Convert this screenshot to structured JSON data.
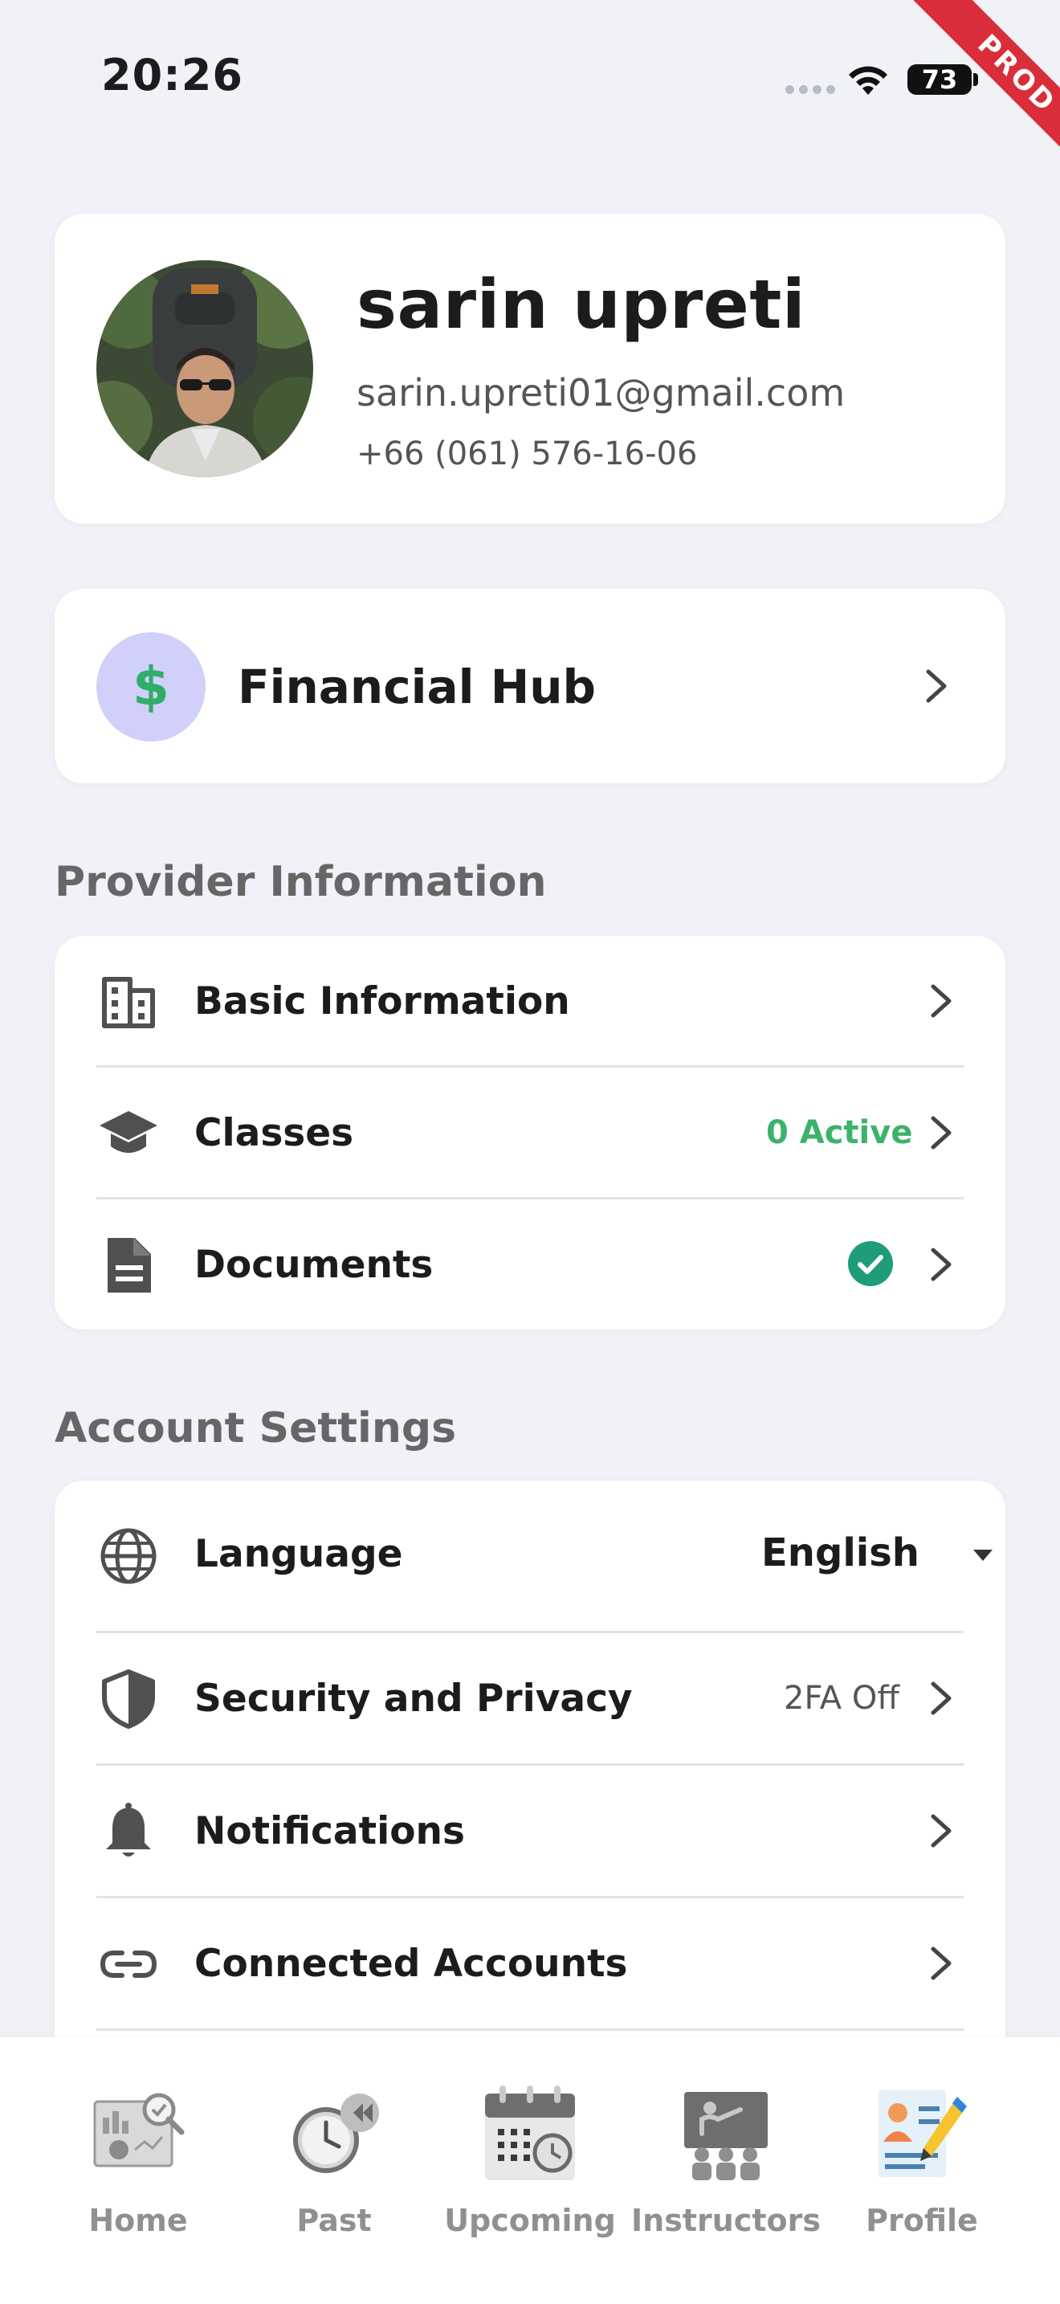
{
  "status_bar": {
    "time": "20:26",
    "battery": "73"
  },
  "ribbon": {
    "label": "PROD"
  },
  "profile": {
    "name": "sarin upreti",
    "email": "sarin.upreti01@gmail.com",
    "phone": "+66 (061) 576-16-06"
  },
  "financial_hub": {
    "label": "Financial Hub",
    "icon_symbol": "$"
  },
  "provider_section": {
    "title": "Provider Information",
    "items": [
      {
        "label": "Basic Information",
        "icon": "building-icon"
      },
      {
        "label": "Classes",
        "icon": "graduation-cap-icon",
        "value": "0 Active",
        "value_color": "#3bb36a"
      },
      {
        "label": "Documents",
        "icon": "document-icon",
        "status": "verified",
        "status_color": "#1f9c7a"
      }
    ]
  },
  "account_section": {
    "title": "Account Settings",
    "items": [
      {
        "label": "Language",
        "icon": "globe-icon",
        "value": "English"
      },
      {
        "label": "Security and Privacy",
        "icon": "shield-icon",
        "value": "2FA Off"
      },
      {
        "label": "Notifications",
        "icon": "bell-icon"
      },
      {
        "label": "Connected Accounts",
        "icon": "link-icon"
      }
    ]
  },
  "bottom_nav": {
    "items": [
      {
        "label": "Home",
        "icon": "dashboard-icon"
      },
      {
        "label": "Past",
        "icon": "history-clock-icon"
      },
      {
        "label": "Upcoming",
        "icon": "calendar-icon"
      },
      {
        "label": "Instructors",
        "icon": "classroom-board-icon"
      },
      {
        "label": "Profile",
        "icon": "profile-edit-icon",
        "active": true
      }
    ]
  },
  "colors": {
    "background": "#f0f2f7",
    "card": "#ffffff",
    "accent_green": "#3bb36a",
    "verified_teal": "#1f9c7a",
    "financial_icon_bg": "#d1d0fb",
    "ribbon_red": "#d92d3a"
  }
}
